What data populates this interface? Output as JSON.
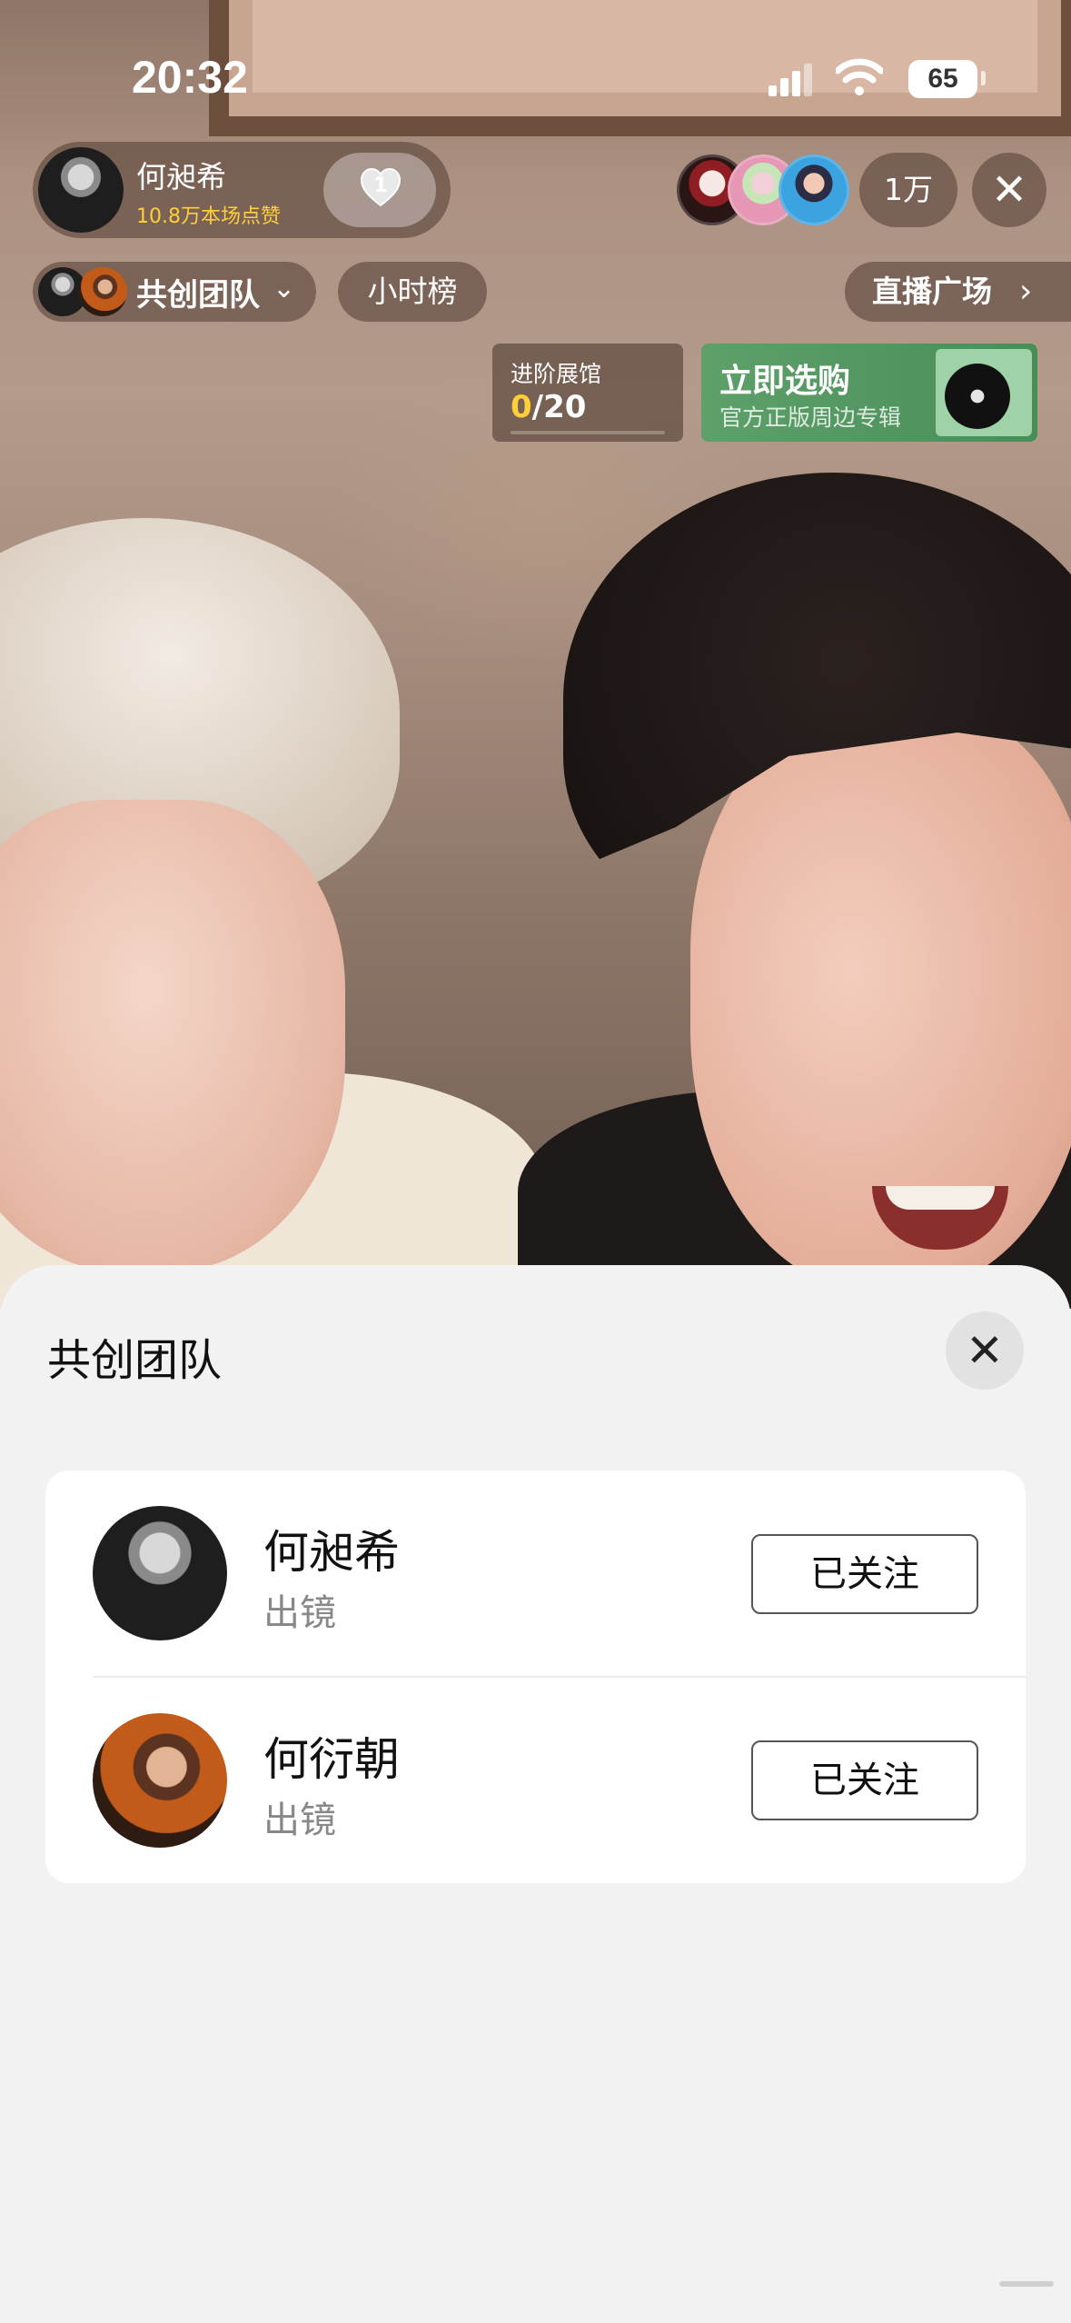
{
  "status_bar": {
    "time": "20:32",
    "battery": "65"
  },
  "live": {
    "host": {
      "name": "何昶希",
      "likes": "10.8万本场点赞",
      "like_count": "1"
    },
    "viewer_count": "1万",
    "team_label": "共创团队",
    "rank_label": "小时榜",
    "plaza_label": "直播广场",
    "exhibit": {
      "title": "进阶展馆",
      "current": "0",
      "total": "/20",
      "progress": 0
    },
    "shop": {
      "title": "立即选购",
      "subtitle": "官方正版周边专辑"
    }
  },
  "sheet": {
    "title": "共创团队",
    "members": [
      {
        "name": "何昶希",
        "role": "出镜",
        "button": "已关注"
      },
      {
        "name": "何衍朝",
        "role": "出镜",
        "button": "已关注"
      }
    ]
  },
  "icons": {
    "close": "close-icon",
    "chevron": "chevron-down-icon",
    "heart": "heart-icon"
  }
}
